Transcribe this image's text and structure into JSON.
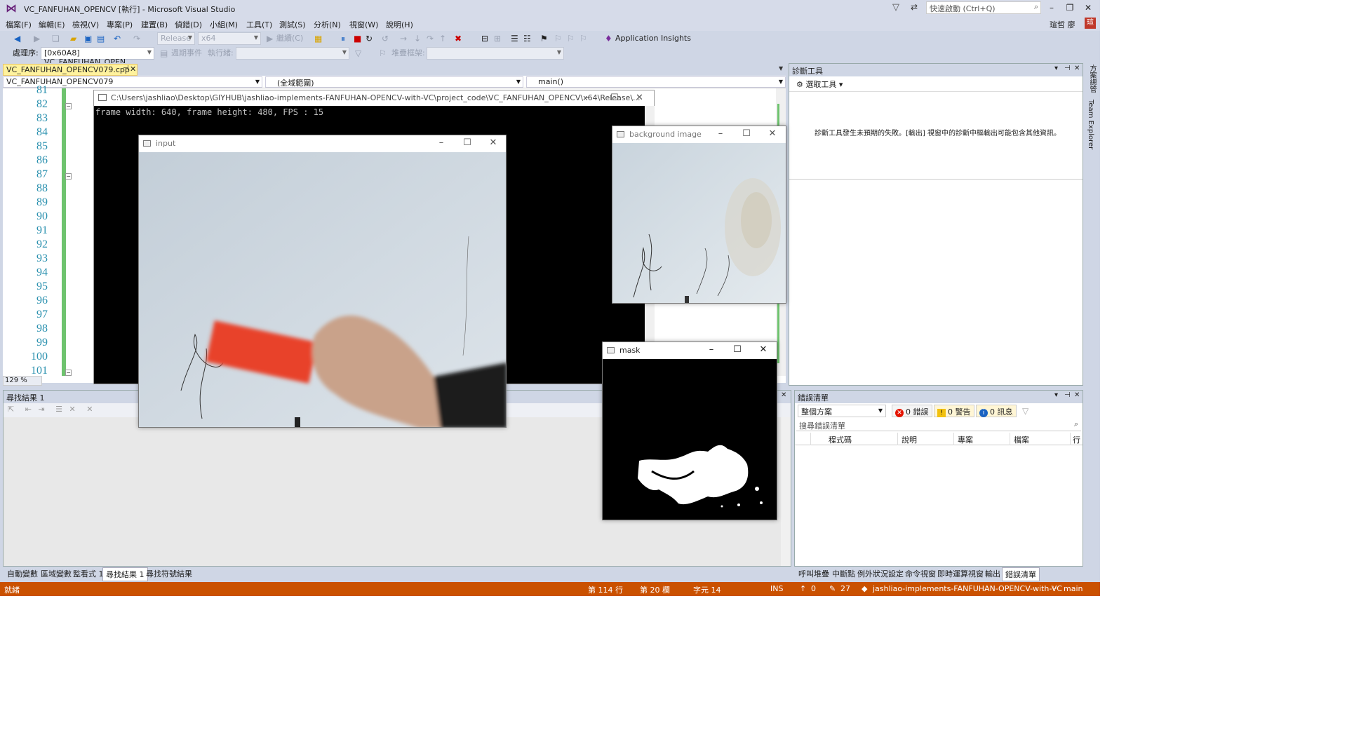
{
  "titlebar": {
    "title": "VC_FANFUHAN_OPENCV [執行] - Microsoft Visual Studio",
    "quick_launch_placeholder": "快速啟動 (Ctrl+Q)"
  },
  "menu": {
    "items": [
      "檔案(F)",
      "編輯(E)",
      "檢視(V)",
      "專案(P)",
      "建置(B)",
      "偵錯(D)",
      "小組(M)",
      "工具(T)",
      "測試(S)",
      "分析(N)",
      "視窗(W)",
      "說明(H)"
    ],
    "user": "瑄哲 廖",
    "user_initial": "瑄"
  },
  "toolbar": {
    "config": "Release",
    "platform": "x64",
    "continue_label": "繼續(C)",
    "app_insights": "Application Insights"
  },
  "debugbar": {
    "process_label": "處理序:",
    "process_value": "[0x60A8] VC_FANFUHAN_OPEN",
    "lifecycle_label": "週期事件",
    "thread_label": "執行緒:",
    "stack_label": "堆疊框架:"
  },
  "editor": {
    "tab_label": "VC_FANFUHAN_OPENCV079.cpp",
    "nav_project": "VC_FANFUHAN_OPENCV079",
    "nav_scope": "(全域範圍)",
    "nav_function": "main()",
    "line_numbers": [
      "81",
      "82",
      "83",
      "84",
      "85",
      "86",
      "87",
      "88",
      "89",
      "90",
      "91",
      "92",
      "93",
      "94",
      "95",
      "96",
      "97",
      "98",
      "99",
      "100",
      "101"
    ],
    "zoom": "129 %"
  },
  "console": {
    "title": "C:\\Users\\jashliao\\Desktop\\GIYHUB\\jashliao-implements-FANFUHAN-OPENCV-with-VC\\project_code\\VC_FANFUHAN_OPENCV\\x64\\Release\\...",
    "output": "frame width: 640, frame height: 480, FPS : 15"
  },
  "diagnostics": {
    "title": "診斷工具",
    "select_tools": "選取工具",
    "message": "診斷工具發生未預期的失敗。[輸出] 視窗中的診斷中樞輸出可能包含其他資訊。"
  },
  "right_strip": [
    "方案總管",
    "Team Explorer"
  ],
  "find_results": {
    "title": "尋找結果 1"
  },
  "bottom_tabs": [
    "自動變數",
    "區域變數",
    "監看式 1",
    "尋找結果 1",
    "尋找符號結果"
  ],
  "bottom_active": "尋找結果 1",
  "error_list": {
    "title": "錯誤清單",
    "scope": "整個方案",
    "errors": "0 錯誤",
    "warnings": "0 警告",
    "messages": "0 訊息",
    "search_placeholder": "搜尋錯誤清單",
    "columns": [
      "程式碼",
      "說明",
      "專案",
      "檔案",
      "行"
    ]
  },
  "error_tabs": [
    "呼叫堆疊",
    "中斷點",
    "例外狀況設定",
    "命令視窗",
    "即時運算視窗",
    "輸出",
    "錯誤清單"
  ],
  "status": {
    "ready": "就緒",
    "line": "第 114 行",
    "col": "第 20 欄",
    "char": "字元 14",
    "ins": "INS",
    "up": "0",
    "edits": "27",
    "repo": "jashliao-implements-FANFUHAN-OPENCV-with-VC",
    "branch": "main"
  },
  "opencv_windows": {
    "input_title": "input",
    "background_title": "background image",
    "mask_title": "mask"
  },
  "colors": {
    "vs_chrome": "#cfd6e5",
    "status_debug": "#ca5100",
    "tab_highlight": "#fff29d",
    "line_number": "#2b91af",
    "change_bar": "#6ec36e"
  }
}
